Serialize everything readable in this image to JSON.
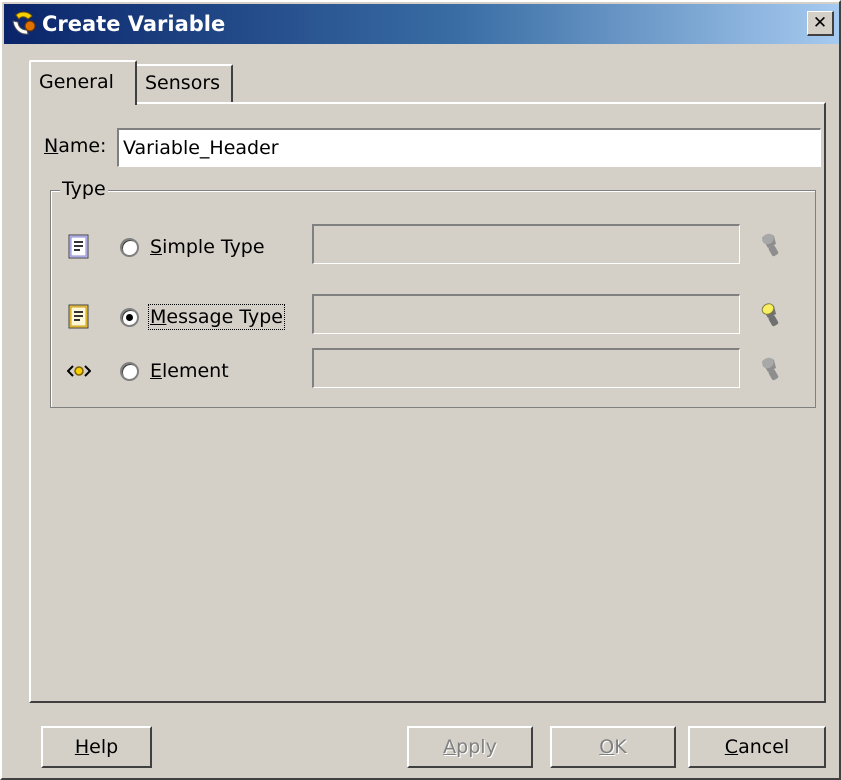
{
  "window": {
    "title": "Create Variable",
    "close_glyph": "✕"
  },
  "tabs": [
    {
      "label": "General",
      "active": true
    },
    {
      "label": "Sensors",
      "active": false
    }
  ],
  "name_field": {
    "label_mnemonic": "N",
    "label_rest": "ame:",
    "value": "Variable_Header"
  },
  "type_group": {
    "legend": "Type",
    "options": [
      {
        "mnemonic": "S",
        "rest": "imple Type",
        "icon": "simple-type-icon",
        "selected": false,
        "value": "",
        "browse_enabled": false
      },
      {
        "mnemonic": "M",
        "rest": "essage Type",
        "icon": "message-type-icon",
        "selected": true,
        "value": "",
        "browse_enabled": true
      },
      {
        "mnemonic": "E",
        "rest": "lement",
        "icon": "element-icon",
        "selected": false,
        "value": "",
        "browse_enabled": false
      }
    ]
  },
  "buttons": {
    "help": {
      "mnemonic": "H",
      "rest": "elp"
    },
    "apply": {
      "mnemonic": "A",
      "rest": "pply"
    },
    "ok": {
      "mnemonic": "O",
      "rest": "K"
    },
    "cancel": {
      "mnemonic": "C",
      "rest": "ancel"
    }
  },
  "colors": {
    "titlebar_start": "#0a246a",
    "titlebar_end": "#a6caf0",
    "dialog_bg": "#d4d0c8",
    "disabled_text": "#808080"
  }
}
